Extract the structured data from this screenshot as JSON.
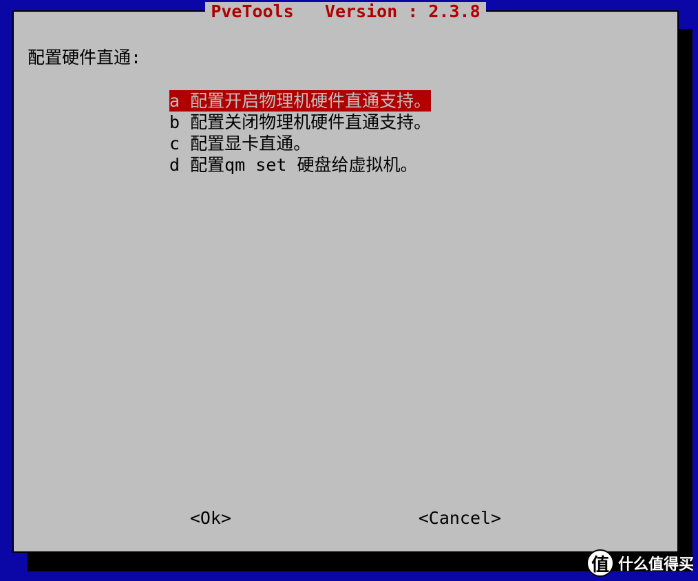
{
  "title": "PveTools   Version : 2.3.8",
  "subtitle": "配置硬件直通:",
  "menu": {
    "selected_index": 0,
    "items": [
      {
        "key": "a",
        "label": "配置开启物理机硬件直通支持。"
      },
      {
        "key": "b",
        "label": "配置关闭物理机硬件直通支持。"
      },
      {
        "key": "c",
        "label": "配置显卡直通。"
      },
      {
        "key": "d",
        "label": "配置qm set 硬盘给虚拟机。"
      }
    ]
  },
  "buttons": {
    "ok": "<Ok>",
    "cancel": "<Cancel>"
  },
  "watermark": {
    "badge": "值",
    "text": "什么值得买"
  },
  "colors": {
    "background": "#0a07a6",
    "panel": "#bfbfbf",
    "accent": "#b00000",
    "text": "#000000"
  }
}
